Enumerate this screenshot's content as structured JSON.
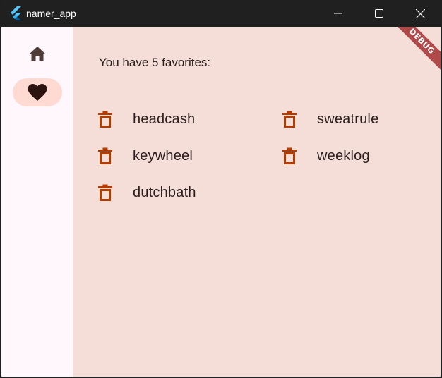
{
  "window": {
    "title": "namer_app"
  },
  "navigation_rail": {
    "items": [
      {
        "icon": "home-icon",
        "selected": false
      },
      {
        "icon": "heart-icon",
        "selected": true
      }
    ],
    "selected_color": "#ffdad3"
  },
  "favorites": {
    "count_text": "You have 5 favorites:",
    "items": [
      {
        "word": "headcash"
      },
      {
        "word": "sweatrule"
      },
      {
        "word": "keywheel"
      },
      {
        "word": "weeklog"
      },
      {
        "word": "dutchbath"
      }
    ]
  },
  "debug_banner": {
    "label": "DEBUG"
  },
  "colors": {
    "background": "#f5ddd8",
    "rail_background": "#fff7fb",
    "trash_icon": "#b23b00",
    "text": "#2b1f1d"
  }
}
